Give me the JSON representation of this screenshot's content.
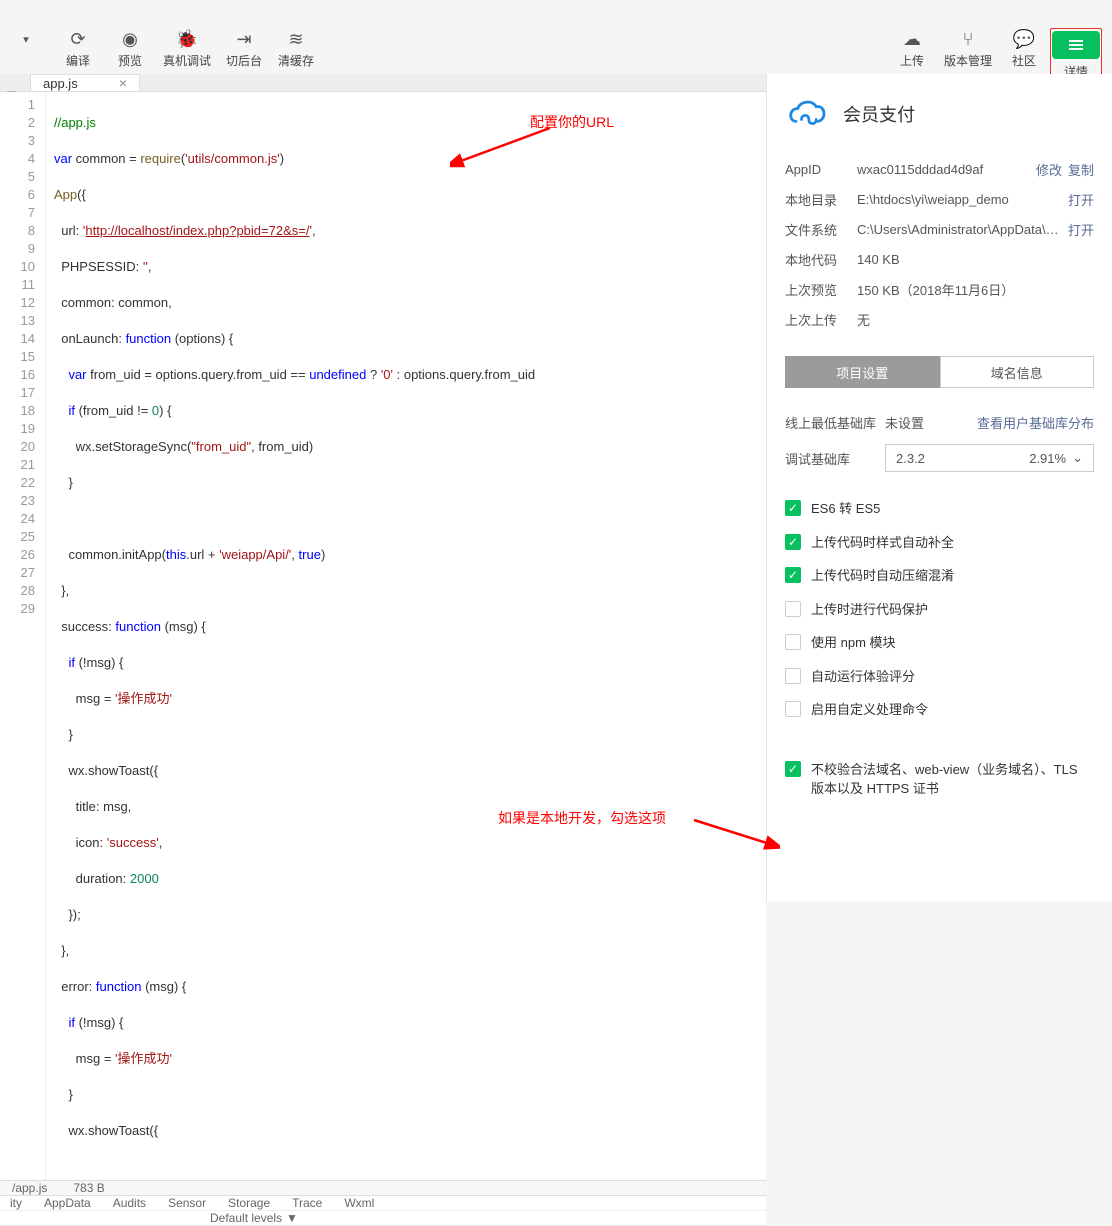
{
  "toolbar": {
    "compile": "编译",
    "preview": "预览",
    "remote_debug": "真机调试",
    "background": "切后台",
    "clear_cache": "清缓存",
    "upload": "上传",
    "version": "版本管理",
    "community": "社区",
    "details": "详情"
  },
  "tabs": {
    "file": "app.js"
  },
  "code": {
    "l1": "//app.js",
    "l2a": "var",
    "l2b": " common = ",
    "l2c": "require",
    "l2d": "(",
    "l2e": "'utils/common.js'",
    "l2f": ")",
    "l3a": "App",
    "l3b": "({",
    "l4a": "  url: ",
    "l4b": "'",
    "l4c": "http://localhost/index.php?pbid=72&s=/",
    "l4d": "'",
    "l4e": ",",
    "l5a": "  PHPSESSID: ",
    "l5b": "''",
    "l5c": ",",
    "l6": "  common: common,",
    "l7a": "  onLaunch: ",
    "l7b": "function",
    "l7c": " (options) {",
    "l8a": "    ",
    "l8b": "var",
    "l8c": " from_uid = options.query.from_uid == ",
    "l8d": "undefined",
    "l8e": " ? ",
    "l8f": "'0'",
    "l8g": " : options.query.from_uid",
    "l9a": "    ",
    "l9b": "if",
    "l9c": " (from_uid != ",
    "l9d": "0",
    "l9e": ") {",
    "l10a": "      wx.setStorageSync(",
    "l10b": "\"from_uid\"",
    "l10c": ", from_uid)",
    "l11": "    }",
    "l12": "",
    "l13a": "    common.initApp(",
    "l13b": "this",
    "l13c": ".url + ",
    "l13d": "'weiapp/Api/'",
    "l13e": ", ",
    "l13f": "true",
    "l13g": ")",
    "l14": "  },",
    "l15a": "  success: ",
    "l15b": "function",
    "l15c": " (msg) {",
    "l16a": "    ",
    "l16b": "if",
    "l16c": " (!msg) {",
    "l17a": "      msg = ",
    "l17b": "'操作成功'",
    "l18": "    }",
    "l19": "    wx.showToast({",
    "l20": "      title: msg,",
    "l21a": "      icon: ",
    "l21b": "'success'",
    "l21c": ",",
    "l22a": "      duration: ",
    "l22b": "2000",
    "l23": "    });",
    "l24": "  },",
    "l25a": "  error: ",
    "l25b": "function",
    "l25c": " (msg) {",
    "l26a": "    ",
    "l26b": "if",
    "l26c": " (!msg) {",
    "l27a": "      msg = ",
    "l27b": "'操作成功'",
    "l28": "    }",
    "l29": "    wx.showToast({"
  },
  "annotation": {
    "url_label": "配置你的URL",
    "check_label": "如果是本地开发，勾选这项"
  },
  "status": {
    "path": "/app.js",
    "size": "783 B"
  },
  "console": {
    "tabs": [
      "ity",
      "AppData",
      "Audits",
      "Sensor",
      "Storage",
      "Trace",
      "Wxml"
    ],
    "levels": "Default levels"
  },
  "side": {
    "title": "会员支付",
    "appid_k": "AppID",
    "appid_v": "wxac0115dddad4d9af",
    "localdir_k": "本地目录",
    "localdir_v": "E:\\htdocs\\yi\\weiapp_demo",
    "filesys_k": "文件系统",
    "filesys_v": "C:\\Users\\Administrator\\AppData\\Local\\...",
    "localcode_k": "本地代码",
    "localcode_v": "140 KB",
    "lastpreview_k": "上次预览",
    "lastpreview_v": "150 KB（2018年11月6日）",
    "lastupload_k": "上次上传",
    "lastupload_v": "无",
    "link_modify": "修改",
    "link_copy": "复制",
    "link_open": "打开",
    "tab_settings": "项目设置",
    "tab_domain": "域名信息",
    "minlib_k": "线上最低基础库",
    "minlib_v": "未设置",
    "minlib_link": "查看用户基础库分布",
    "debuglib_k": "调试基础库",
    "debuglib_v": "2.3.2",
    "debuglib_pct": "2.91%",
    "chk1": "ES6 转 ES5",
    "chk2": "上传代码时样式自动补全",
    "chk3": "上传代码时自动压缩混淆",
    "chk4": "上传时进行代码保护",
    "chk5": "使用 npm 模块",
    "chk6": "自动运行体验评分",
    "chk7": "启用自定义处理命令",
    "chk8": "不校验合法域名、web-view（业务域名）、TLS 版本以及 HTTPS 证书"
  }
}
